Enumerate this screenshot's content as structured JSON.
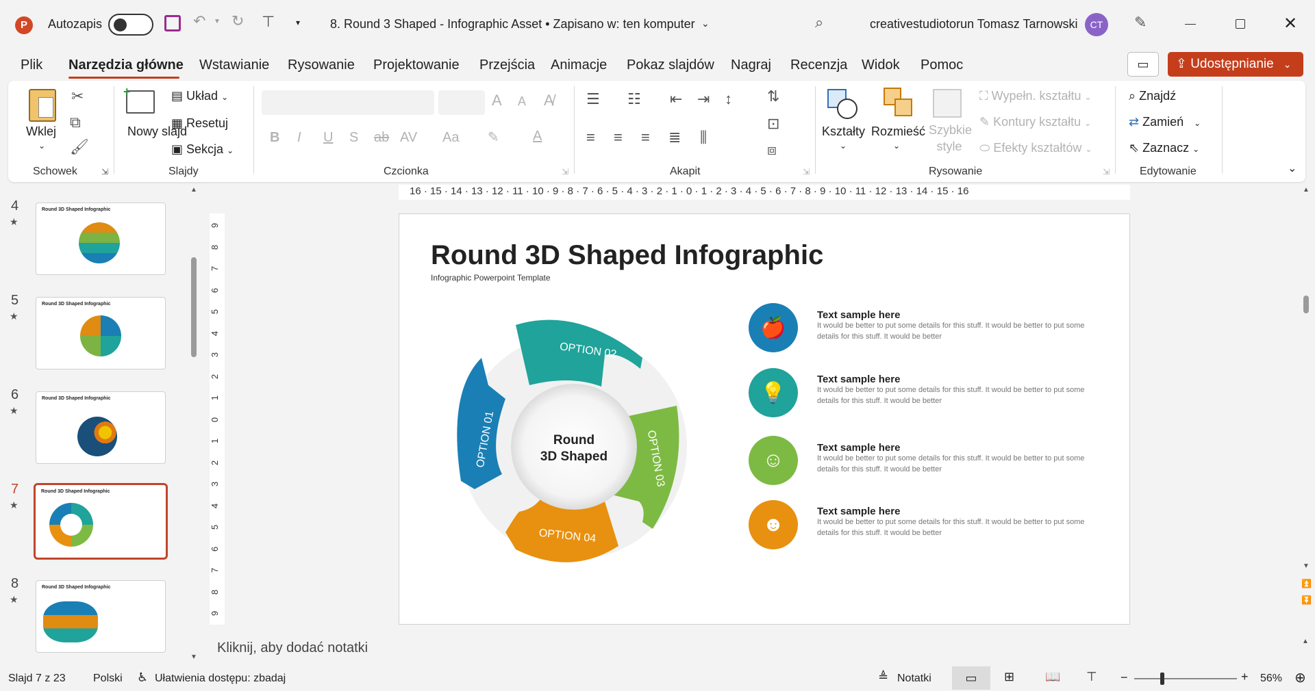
{
  "titlebar": {
    "autosave_label": "Autozapis",
    "doc_title": "8. Round 3 Shaped - Infographic Asset • Zapisano w: ten komputer",
    "user_name": "creativestudiotorun Tomasz Tarnowski",
    "user_initials": "CT"
  },
  "menu": {
    "items": [
      "Plik",
      "Narzędzia główne",
      "Wstawianie",
      "Rysowanie",
      "Projektowanie",
      "Przejścia",
      "Animacje",
      "Pokaz slajdów",
      "Nagraj",
      "Recenzja",
      "Widok",
      "Pomoc"
    ],
    "share_label": "Udostępnianie"
  },
  "ribbon": {
    "schowek": {
      "paste_label": "Wklej",
      "group_label": "Schowek"
    },
    "slajdy": {
      "new_slide_label": "Nowy slajd",
      "layout_label": "Układ",
      "reset_label": "Resetuj",
      "section_label": "Sekcja",
      "group_label": "Slajdy"
    },
    "czcionka": {
      "group_label": "Czcionka",
      "bold": "B",
      "italic": "I",
      "underline": "U",
      "strike": "S",
      "abc": "ab",
      "spacing": "AV",
      "case": "Aa",
      "grow": "A",
      "shrink": "A"
    },
    "akapit": {
      "group_label": "Akapit"
    },
    "rysowanie": {
      "shapes_label": "Kształty",
      "arrange_label": "Rozmieść",
      "quick_styles_label": "Szybkie style",
      "fill_label": "Wypełn. kształtu",
      "outline_label": "Kontury kształtu",
      "effects_label": "Efekty kształtów",
      "group_label": "Rysowanie"
    },
    "edytowanie": {
      "find_label": "Znajdź",
      "replace_label": "Zamień",
      "select_label": "Zaznacz",
      "group_label": "Edytowanie"
    }
  },
  "thumbnails": [
    {
      "num": "4",
      "title": "Round 3D Shaped Infographic"
    },
    {
      "num": "5",
      "title": "Round 3D Shaped Infographic"
    },
    {
      "num": "6",
      "title": "Round 3D Shaped Infographic"
    },
    {
      "num": "7",
      "title": "Round 3D Shaped Infographic",
      "selected": true
    },
    {
      "num": "8",
      "title": "Round 3D Shaped Infographic"
    }
  ],
  "ruler": {
    "h_ticks": "16 · 15 · 14 · 13 · 12 · 11 · 10 · 9 · 8 · 7 · 6 · 5 · 4 · 3 · 2 · 1 · 0 · 1 · 2 · 3 · 4 · 5 · 6 · 7 · 8 · 9 · 10 · 11 · 12 · 13 · 14 · 15 · 16",
    "v_ticks": [
      "9",
      "8",
      "7",
      "6",
      "5",
      "4",
      "3",
      "2",
      "1",
      "0",
      "1",
      "2",
      "3",
      "4",
      "5",
      "6",
      "7",
      "8",
      "9"
    ]
  },
  "slide": {
    "title": "Round 3D Shaped Infographic",
    "subtitle": "Infographic Powerpoint Template",
    "center_label_1": "Round",
    "center_label_2": "3D Shaped",
    "options": [
      "OPTION 01",
      "OPTION 02",
      "OPTION 03",
      "OPTION 04"
    ],
    "option_colors": [
      "#1a7fb5",
      "#1fa39a",
      "#7dba43",
      "#e8900f"
    ],
    "items": [
      {
        "title": "Text sample here",
        "desc": "It would be better to put some details for this stuff. It would be better to put some details for this stuff. It would be better",
        "icon": "apple-icon",
        "color": "#1a7fb5"
      },
      {
        "title": "Text sample here",
        "desc": "It would be better to put some details for this stuff. It would be better to put some details for this stuff. It would be better",
        "icon": "lightbulb-icon",
        "color": "#1fa39a"
      },
      {
        "title": "Text sample here",
        "desc": "It would be better to put some details for this stuff. It would be better to put some details for this stuff. It would be better",
        "icon": "mask-icon",
        "color": "#7dba43"
      },
      {
        "title": "Text sample here",
        "desc": "It would be better to put some details for this stuff. It would be better to put some details for this stuff. It would be better",
        "icon": "theater-masks-icon",
        "color": "#e8900f"
      }
    ]
  },
  "notes_placeholder": "Kliknij, aby dodać notatki",
  "status": {
    "slide_info": "Slajd 7 z 23",
    "language": "Polski",
    "accessibility": "Ułatwienia dostępu: zbadaj",
    "notes_label": "Notatki",
    "zoom": "56%"
  }
}
